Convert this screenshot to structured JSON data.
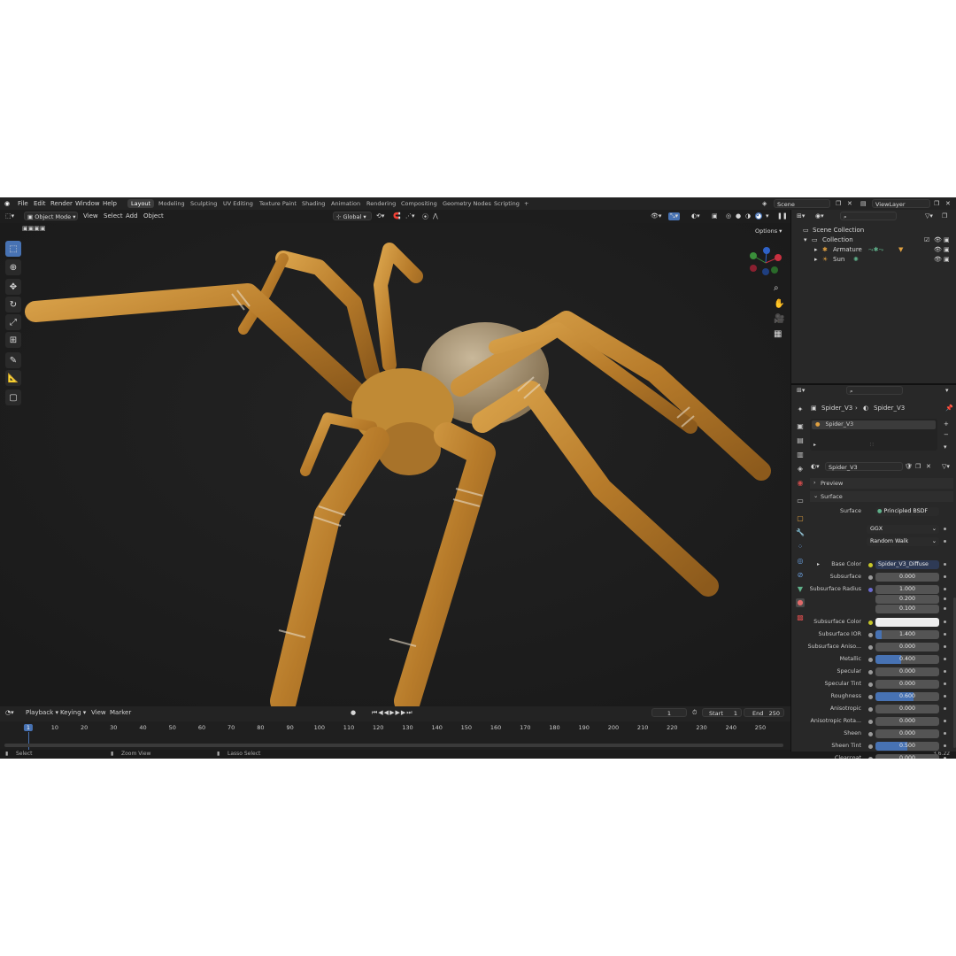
{
  "top_menu": [
    "File",
    "Edit",
    "Render",
    "Window",
    "Help"
  ],
  "workspaces": [
    "Layout",
    "Modeling",
    "Sculpting",
    "UV Editing",
    "Texture Paint",
    "Shading",
    "Animation",
    "Rendering",
    "Compositing",
    "Geometry Nodes",
    "Scripting"
  ],
  "active_workspace": "Layout",
  "scene_name": "Scene",
  "view_layer": "ViewLayer",
  "viewport_header": {
    "mode": "Object Mode",
    "menus": [
      "View",
      "Select",
      "Add",
      "Object"
    ],
    "orientation": "Global",
    "options_label": "Options"
  },
  "outliner": {
    "root": "Scene Collection",
    "collection": "Collection",
    "items": [
      "Armature",
      "Sun"
    ]
  },
  "properties": {
    "breadcrumb_object": "Spider_V3",
    "breadcrumb_material": "Spider_V3",
    "material_slot": "Spider_V3",
    "material_name": "Spider_V3",
    "sections": [
      "Preview",
      "Surface"
    ],
    "surface_label": "Surface",
    "surface_shader": "Principled BSDF",
    "distribution": "GGX",
    "subsurface_method": "Random Walk",
    "rows": [
      {
        "label": "Base Color",
        "value": "Spider_V3_Diffuse",
        "kind": "link",
        "fill": 0
      },
      {
        "label": "Subsurface",
        "value": "0.000",
        "kind": "num",
        "fill": 0
      },
      {
        "label": "Subsurface Radius",
        "value": "1.000",
        "kind": "num",
        "fill": 0
      },
      {
        "label": "",
        "value": "0.200",
        "kind": "num",
        "fill": 0
      },
      {
        "label": "",
        "value": "0.100",
        "kind": "num",
        "fill": 0
      },
      {
        "label": "Subsurface Color",
        "value": "",
        "kind": "color",
        "fill": 0
      },
      {
        "label": "Subsurface IOR",
        "value": "1.400",
        "kind": "num",
        "fill": 0.1
      },
      {
        "label": "Subsurface Aniso...",
        "value": "0.000",
        "kind": "num",
        "fill": 0
      },
      {
        "label": "Metallic",
        "value": "0.400",
        "kind": "num",
        "fill": 0.4
      },
      {
        "label": "Specular",
        "value": "0.000",
        "kind": "num",
        "fill": 0
      },
      {
        "label": "Specular Tint",
        "value": "0.000",
        "kind": "num",
        "fill": 0
      },
      {
        "label": "Roughness",
        "value": "0.600",
        "kind": "num",
        "fill": 0.6
      },
      {
        "label": "Anisotropic",
        "value": "0.000",
        "kind": "num",
        "fill": 0
      },
      {
        "label": "Anisotropic Rota...",
        "value": "0.000",
        "kind": "num",
        "fill": 0
      },
      {
        "label": "Sheen",
        "value": "0.000",
        "kind": "num",
        "fill": 0
      },
      {
        "label": "Sheen Tint",
        "value": "0.500",
        "kind": "num",
        "fill": 0.5
      },
      {
        "label": "Clearcoat",
        "value": "0.000",
        "kind": "num",
        "fill": 0
      }
    ]
  },
  "timeline": {
    "menus": [
      "Playback",
      "Keying",
      "View",
      "Marker"
    ],
    "current_frame": "1",
    "start_label": "Start",
    "start": "1",
    "end_label": "End",
    "end": "250",
    "ticks": [
      "1",
      "10",
      "20",
      "30",
      "40",
      "50",
      "60",
      "70",
      "80",
      "90",
      "100",
      "110",
      "120",
      "130",
      "140",
      "150",
      "160",
      "170",
      "180",
      "190",
      "200",
      "210",
      "220",
      "230",
      "240",
      "250"
    ]
  },
  "status": {
    "select": "Select",
    "zoom": "Zoom View",
    "lasso": "Lasso Select",
    "version": "3.6.22"
  },
  "colors": {
    "accent": "#4772b3",
    "bg": "#1d1d1d",
    "panel": "#282828"
  }
}
